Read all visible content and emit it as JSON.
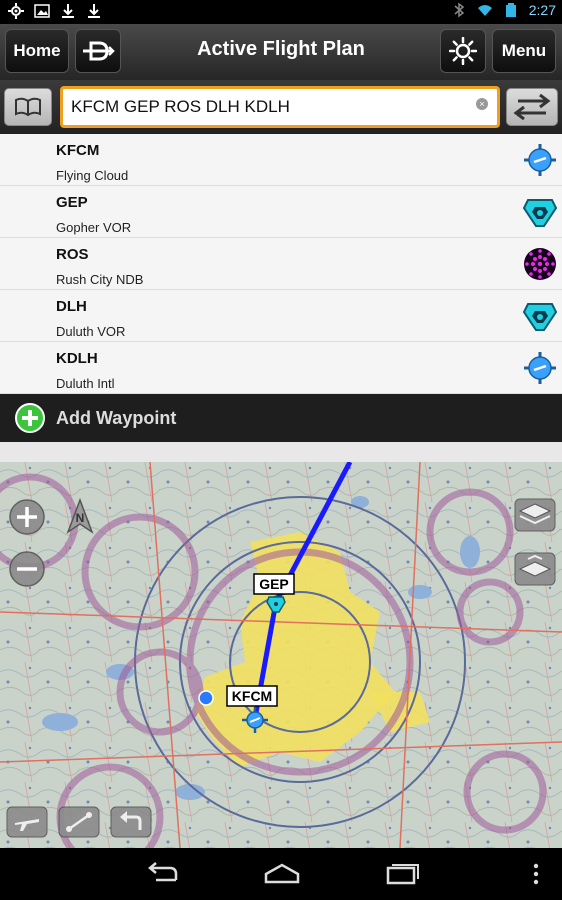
{
  "status": {
    "time": "2:27"
  },
  "toolbar": {
    "home_label": "Home",
    "title": "Active Flight Plan",
    "menu_label": "Menu"
  },
  "search": {
    "route": "KFCM GEP ROS DLH KDLH"
  },
  "waypoints": [
    {
      "id": "KFCM",
      "name": "Flying Cloud",
      "icon": "airport-icon"
    },
    {
      "id": "GEP",
      "name": "Gopher VOR",
      "icon": "vor-icon"
    },
    {
      "id": "ROS",
      "name": "Rush City NDB",
      "icon": "ndb-icon"
    },
    {
      "id": "DLH",
      "name": "Duluth VOR",
      "icon": "vor-icon"
    },
    {
      "id": "KDLH",
      "name": "Duluth Intl",
      "icon": "airport-icon"
    }
  ],
  "add_waypoint": {
    "label": "Add Waypoint"
  },
  "map": {
    "labels": {
      "gep": "GEP",
      "kfcm": "KFCM"
    },
    "compass": "N"
  },
  "colors": {
    "route": "#1a1aff",
    "accent": "#f0a020",
    "airport": "#3aa0ff",
    "vor": "#20d0e0",
    "ndb": "#c020c0"
  }
}
